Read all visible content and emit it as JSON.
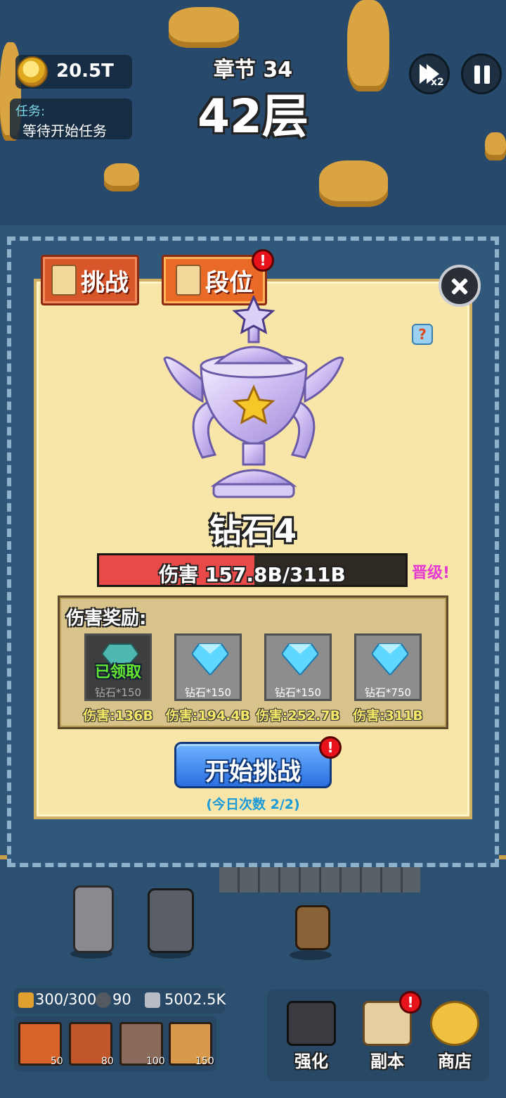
{
  "hud": {
    "coins": "20.5T",
    "task_label": "任务:",
    "task_text": "等待开始任务",
    "chapter": "章节 34",
    "floor": "42层",
    "speed_label": "x2"
  },
  "dialog": {
    "tabs": [
      {
        "label": "挑战",
        "icon": "scroll-icon"
      },
      {
        "label": "段位",
        "icon": "figure-icon",
        "alert": "!"
      }
    ],
    "help": "?",
    "rank_name": "钻石4",
    "progress": {
      "label": "伤害 157.8B/311B",
      "fraction": 0.507
    },
    "promote": "晋级!",
    "rewards_title": "伤害奖励:",
    "rewards": [
      {
        "amount": "钻石*150",
        "damage": "伤害:136B",
        "claimed": true,
        "claimed_label": "已领取",
        "color": "#4fb8b0"
      },
      {
        "amount": "钻石*150",
        "damage": "伤害:194.4B",
        "claimed": false,
        "color": "#5fd8ff"
      },
      {
        "amount": "钻石*150",
        "damage": "伤害:252.7B",
        "claimed": false,
        "color": "#5fd8ff"
      },
      {
        "amount": "钻石*750",
        "damage": "伤害:311B",
        "claimed": false,
        "color": "#5fd8ff"
      }
    ],
    "start_button": "开始挑战",
    "start_alert": "!",
    "daily_count": "(今日次数 2/2)"
  },
  "bottom": {
    "stats": {
      "energy": "300/300",
      "stone": "90",
      "attack": "5002.5K"
    },
    "skills": [
      {
        "icon": "explosion-icon",
        "cost": "50"
      },
      {
        "icon": "fire-beast-icon",
        "cost": "80"
      },
      {
        "icon": "spikes-icon",
        "cost": "100"
      },
      {
        "icon": "angel-icon",
        "cost": "150"
      }
    ],
    "menu": [
      {
        "label": "强化",
        "icon": "hat-icon"
      },
      {
        "label": "副本",
        "icon": "map-icon",
        "alert": "!"
      },
      {
        "label": "商店",
        "icon": "shop-medal-icon"
      }
    ]
  }
}
